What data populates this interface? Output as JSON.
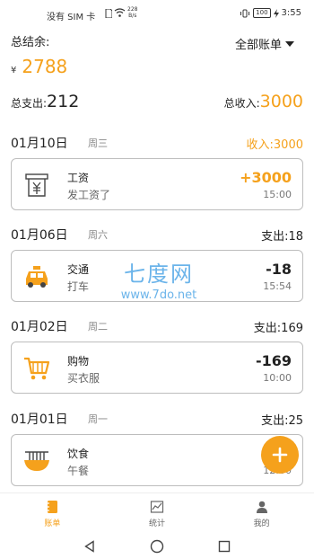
{
  "status_bar": {
    "carrier": "没有 SIM 卡",
    "net_speed_value": "228",
    "net_speed_unit": "B/s",
    "battery": "100",
    "time": "3:55"
  },
  "summary": {
    "balance_label": "总结余:",
    "filter_label": "全部账单",
    "currency": "¥",
    "balance": "2788",
    "expense_label": "总支出:",
    "expense": "212",
    "income_label": "总收入:",
    "income": "3000"
  },
  "days": [
    {
      "date": "01月10日",
      "weekday": "周三",
      "summary": "收入:3000",
      "record": {
        "category": "工资",
        "note": "发工资了",
        "amount": "+3000",
        "time": "15:00",
        "icon": "salary-icon"
      }
    },
    {
      "date": "01月06日",
      "weekday": "周六",
      "summary": "支出:18",
      "record": {
        "category": "交通",
        "note": "打车",
        "amount": "-18",
        "time": "15:54",
        "icon": "taxi-icon"
      }
    },
    {
      "date": "01月02日",
      "weekday": "周二",
      "summary": "支出:169",
      "record": {
        "category": "购物",
        "note": "买衣服",
        "amount": "-169",
        "time": "10:00",
        "icon": "shopping-cart-icon"
      }
    },
    {
      "date": "01月01日",
      "weekday": "周一",
      "summary": "支出:25",
      "record": {
        "category": "饮食",
        "note": "午餐",
        "amount": "",
        "time": "12:00",
        "icon": "noodle-bowl-icon"
      }
    }
  ],
  "watermark": {
    "big": "七度网",
    "small": "www.7do.net"
  },
  "tabs": [
    {
      "label": "账单",
      "icon": "notebook-icon",
      "active": true
    },
    {
      "label": "统计",
      "icon": "chart-icon",
      "active": false
    },
    {
      "label": "我的",
      "icon": "user-icon",
      "active": false
    }
  ],
  "colors": {
    "accent": "#f5a11c",
    "watermark": "#6bb4ea"
  }
}
